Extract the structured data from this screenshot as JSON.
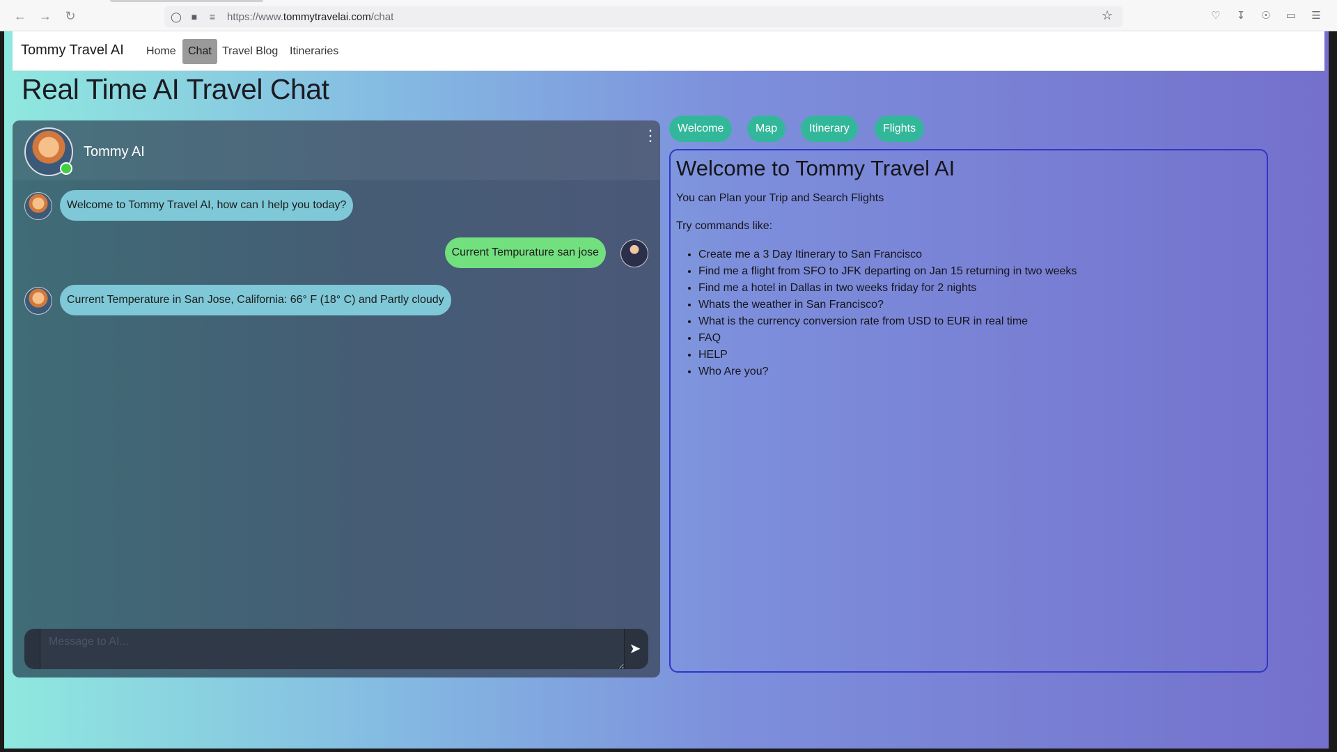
{
  "browser": {
    "url_prefix": "https://www.",
    "url_host": "tommytravelai.com",
    "url_path": "/chat"
  },
  "navbar": {
    "brand": "Tommy Travel AI",
    "links": [
      {
        "label": "Home",
        "active": false
      },
      {
        "label": "Chat",
        "active": true
      },
      {
        "label": "Travel Blog",
        "active": false
      },
      {
        "label": "Itineraries",
        "active": false
      }
    ]
  },
  "page_title": "Real Time AI Travel Chat",
  "chat": {
    "bot_name": "Tommy AI",
    "status_color": "#41d041",
    "messages": [
      {
        "from": "bot",
        "text": "Welcome to Tommy Travel AI, how can I help you today?"
      },
      {
        "from": "user",
        "text": "Current Tempurature san jose"
      },
      {
        "from": "bot",
        "text": "Current Temperature in San Jose, California: 66° F (18° C) and Partly cloudy"
      }
    ],
    "input_placeholder": "Message to AI..."
  },
  "tabs": [
    "Welcome",
    "Map",
    "Itinerary",
    "Flights"
  ],
  "welcome": {
    "title": "Welcome to Tommy Travel AI",
    "subtitle": "You can Plan your Trip and Search Flights",
    "try_label": "Try commands like:",
    "commands": [
      "Create me a 3 Day Itinerary to San Francisco",
      "Find me a flight from SFO to JFK departing on Jan 15 returning in two weeks",
      "Find me a hotel in Dallas in two weeks friday for 2 nights",
      "Whats the weather in San Francisco?",
      "What is the currency conversion rate from USD to EUR in real time",
      "FAQ",
      "HELP",
      "Who Are you?"
    ]
  },
  "colors": {
    "tab_button": "#33b79a",
    "bot_bubble": "#7fc8d7",
    "user_bubble": "#72e07e",
    "panel_border": "#2f35c8"
  }
}
